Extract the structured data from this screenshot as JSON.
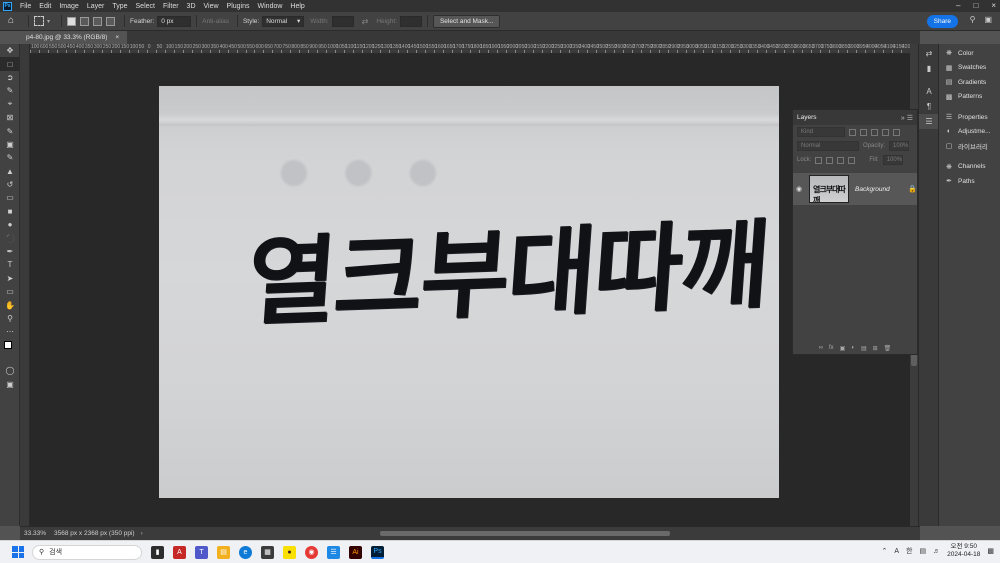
{
  "menubar": {
    "items": [
      "File",
      "Edit",
      "Image",
      "Layer",
      "Type",
      "Select",
      "Filter",
      "3D",
      "View",
      "Plugins",
      "Window",
      "Help"
    ],
    "app_icon": "Ps"
  },
  "options": {
    "feather_label": "Feather:",
    "feather_value": "0 px",
    "antialias_label": "Anti-alias",
    "style_label": "Style:",
    "style_value": "Normal",
    "width_label": "Width:",
    "height_label": "Height:",
    "select_mask_label": "Select and Mask...",
    "share_label": "Share"
  },
  "document": {
    "tab_title": "p4-80.jpg @ 33.3% (RGB/8)",
    "close_glyph": "×",
    "calligraphy_text": "열크부대따깨"
  },
  "ruler": {
    "top_labels": [
      "100",
      "600",
      "550",
      "500",
      "450",
      "400",
      "350",
      "300",
      "250",
      "200",
      "150",
      "100",
      "50",
      "0",
      "50",
      "100",
      "150",
      "200",
      "250",
      "300",
      "350",
      "400",
      "450",
      "500",
      "550",
      "600",
      "650",
      "700",
      "750",
      "800",
      "850",
      "900",
      "950",
      "1000",
      "1050",
      "1100",
      "1150",
      "1200",
      "1250",
      "1300",
      "1350",
      "1400",
      "1450",
      "1500",
      "1550",
      "1600",
      "1650",
      "1700",
      "1750",
      "1800",
      "1850",
      "1900",
      "1950",
      "2000",
      "2050",
      "2100",
      "2150",
      "2200",
      "2250",
      "2300",
      "2350",
      "2400",
      "2450",
      "2500",
      "2550",
      "2600",
      "2650",
      "2700",
      "2750",
      "2800",
      "2850",
      "2900",
      "2950",
      "3000",
      "3050",
      "3100",
      "3150",
      "3200",
      "3250",
      "3300",
      "3350",
      "3400",
      "3450",
      "3500",
      "3550",
      "3600",
      "3650",
      "3700",
      "3750",
      "3800",
      "3850",
      "3900",
      "3950",
      "4000",
      "4050",
      "4100",
      "4150",
      "4200"
    ]
  },
  "status": {
    "zoom": "33.33%",
    "doc_info": "3568 px x 2368 px (350 ppi)"
  },
  "layers_panel": {
    "title": "Layers",
    "kind_placeholder": "Kind",
    "blend_mode": "Normal",
    "opacity_label": "Opacity:",
    "opacity_value": "100%",
    "lock_label": "Lock:",
    "fill_label": "Fill:",
    "fill_value": "100%",
    "layer_name": "Background",
    "thumb_text": "열크부대따깨"
  },
  "right_panel": {
    "items": [
      {
        "label": "Color",
        "icon": "color-wheel-icon"
      },
      {
        "label": "Swatches",
        "icon": "grid-icon"
      },
      {
        "label": "Gradients",
        "icon": "gradient-icon"
      },
      {
        "label": "Patterns",
        "icon": "pattern-icon"
      }
    ],
    "items2": [
      {
        "label": "Properties",
        "icon": "sliders-icon"
      },
      {
        "label": "Adjustme...",
        "icon": "circle-half-icon"
      },
      {
        "label": "라이브러리",
        "icon": "library-icon"
      }
    ],
    "items3": [
      {
        "label": "Channels",
        "icon": "channels-icon"
      },
      {
        "label": "Paths",
        "icon": "pen-path-icon"
      }
    ]
  },
  "taskbar": {
    "search_placeholder": "검색",
    "time_ampm": "오전 9:50",
    "date": "2024-04-18",
    "ime": "한",
    "font_letter": "A"
  },
  "colors": {
    "accent": "#1473e6",
    "ps_blue": "#31a8ff"
  }
}
